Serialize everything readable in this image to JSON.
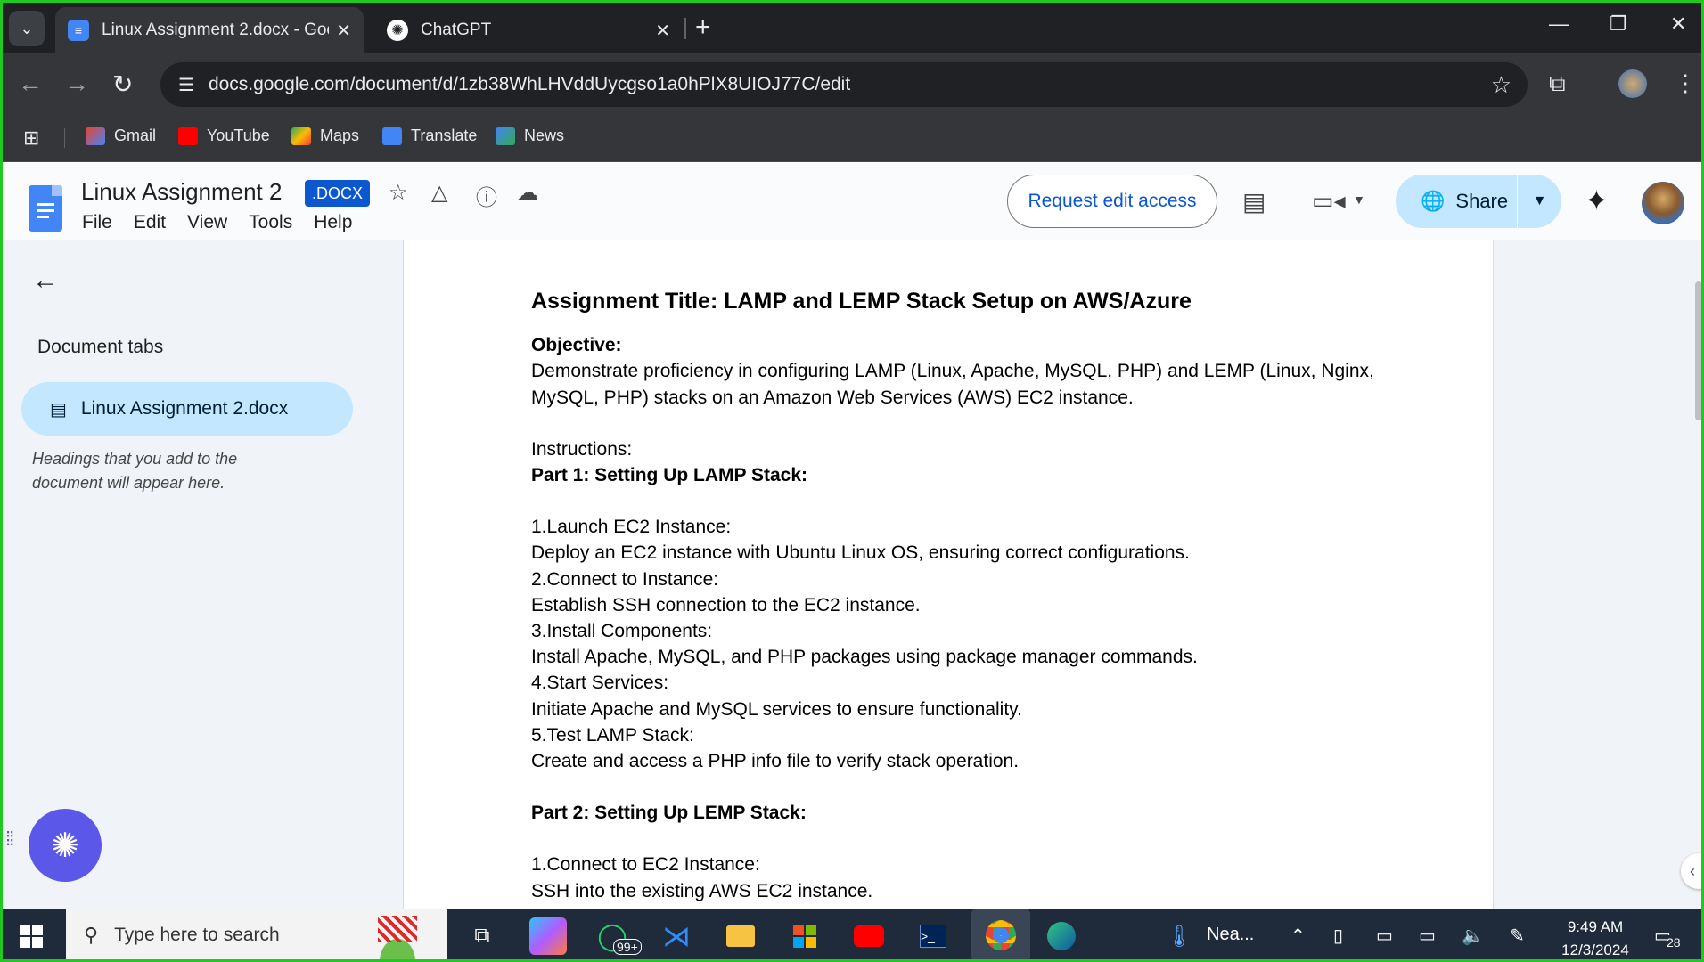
{
  "browser": {
    "tabs": [
      {
        "title": "Linux Assignment 2.docx - Goo",
        "favicon": "google-docs-icon",
        "active": true
      },
      {
        "title": "ChatGPT",
        "favicon": "chatgpt-icon",
        "active": false
      }
    ],
    "url": "docs.google.com/document/d/1zb38WhLHVddUycgso1a0hPlX8UIOJ77C/edit",
    "bookmarks": [
      {
        "label": "Gmail",
        "icon": "gmail-icon",
        "color": "#ea4335"
      },
      {
        "label": "YouTube",
        "icon": "youtube-icon",
        "color": "#ff0000"
      },
      {
        "label": "Maps",
        "icon": "maps-icon",
        "color": "#34a853"
      },
      {
        "label": "Translate",
        "icon": "translate-icon",
        "color": "#4285f4"
      },
      {
        "label": "News",
        "icon": "news-icon",
        "color": "#4285f4"
      }
    ]
  },
  "docs": {
    "title": "Linux Assignment 2",
    "badge": ".DOCX",
    "menus": [
      "File",
      "Edit",
      "View",
      "Tools",
      "Help"
    ],
    "request_edit": "Request edit access",
    "share": "Share"
  },
  "sidebar": {
    "heading": "Document tabs",
    "tab_label": "Linux Assignment 2.docx",
    "hint": "Headings that you add to the document will appear here."
  },
  "document": {
    "title": "Assignment Title: LAMP and LEMP Stack Setup on AWS/Azure",
    "objective_label": "Objective:",
    "objective_text": "Demonstrate proficiency in configuring LAMP (Linux, Apache, MySQL, PHP) and LEMP (Linux, Nginx, MySQL, PHP) stacks on an Amazon Web Services (AWS) EC2 instance.",
    "instructions": "Instructions:",
    "part1": "Part 1: Setting Up LAMP Stack:",
    "part1_steps": [
      {
        "step": "1.Launch EC2 Instance:",
        "detail": "Deploy an EC2 instance with Ubuntu Linux OS, ensuring correct configurations."
      },
      {
        "step": "2.Connect to Instance:",
        "detail": "Establish SSH connection to the EC2 instance."
      },
      {
        "step": "3.Install Components:",
        "detail": "Install Apache, MySQL, and PHP packages using package manager commands."
      },
      {
        "step": "4.Start Services:",
        "detail": "Initiate Apache and MySQL services to ensure functionality."
      },
      {
        "step": "5.Test LAMP Stack:",
        "detail": "Create and access a PHP info file to verify stack operation."
      }
    ],
    "part2": "Part 2: Setting Up LEMP Stack:",
    "part2_steps": [
      {
        "step": "1.Connect to EC2 Instance:",
        "detail": "SSH into the existing AWS EC2 instance."
      }
    ]
  },
  "taskbar": {
    "search_placeholder": "Type here to search",
    "whatsapp_badge": "99+",
    "weather_label": "Nea...",
    "time": "9:49 AM",
    "date": "12/3/2024",
    "notifications": "28"
  }
}
